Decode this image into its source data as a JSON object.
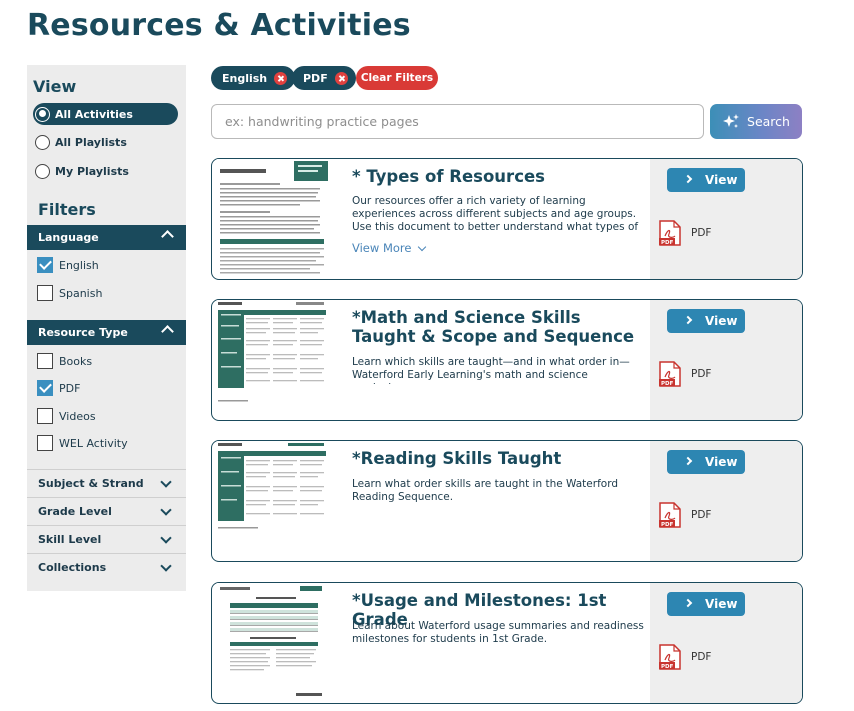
{
  "page": {
    "title": "Resources & Activities"
  },
  "sidebar": {
    "view_heading": "View",
    "view_options": [
      {
        "label": "All Activities",
        "selected": true
      },
      {
        "label": "All Playlists",
        "selected": false
      },
      {
        "label": "My Playlists",
        "selected": false
      }
    ],
    "filters_heading": "Filters",
    "language": {
      "label": "Language",
      "expanded": true,
      "options": [
        {
          "label": "English",
          "checked": true
        },
        {
          "label": "Spanish",
          "checked": false
        }
      ]
    },
    "resource_type": {
      "label": "Resource Type",
      "expanded": true,
      "options": [
        {
          "label": "Books",
          "checked": false
        },
        {
          "label": "PDF",
          "checked": true
        },
        {
          "label": "Videos",
          "checked": false
        },
        {
          "label": "WEL Activity",
          "checked": false
        }
      ]
    },
    "collapsed_filters": [
      "Subject & Strand",
      "Grade Level",
      "Skill Level",
      "Collections"
    ]
  },
  "active_filters": {
    "chips": [
      "English",
      "PDF"
    ],
    "clear_label": "Clear Filters"
  },
  "search": {
    "placeholder": "ex: handwriting practice pages",
    "value": "",
    "button_label": "Search"
  },
  "results": [
    {
      "title": "* Types of Resources",
      "description": "Our resources offer a rich variety of learning experiences across different subjects and age groups. Use this document to better understand what types of resources",
      "view_more": "View More",
      "view_label": "View",
      "file_label": "PDF"
    },
    {
      "title": "*Math and Science Skills Taught & Scope and Sequence",
      "description": "Learn which skills are taught—and in what order in—Waterford Early Learning's math and science curriculum.",
      "view_label": "View",
      "file_label": "PDF"
    },
    {
      "title": "*Reading Skills Taught",
      "description": "Learn what order skills are taught in the Waterford Reading Sequence.",
      "view_label": "View",
      "file_label": "PDF"
    },
    {
      "title": "*Usage and Milestones: 1st Grade",
      "description": "Learn about Waterford usage summaries and readiness milestones for students in 1st Grade.",
      "view_label": "View",
      "file_label": "PDF"
    }
  ],
  "colors": {
    "brand_teal": "#1a4a5c",
    "view_button": "#2d86b2",
    "clear_red": "#d93a36",
    "checkbox_blue": "#3a8fc0",
    "pdf_red": "#c8342f"
  },
  "icons": [
    "close-icon",
    "sparkle-icon",
    "chevron-right-icon",
    "chevron-down-icon",
    "chevron-up-icon",
    "pdf-file-icon"
  ]
}
